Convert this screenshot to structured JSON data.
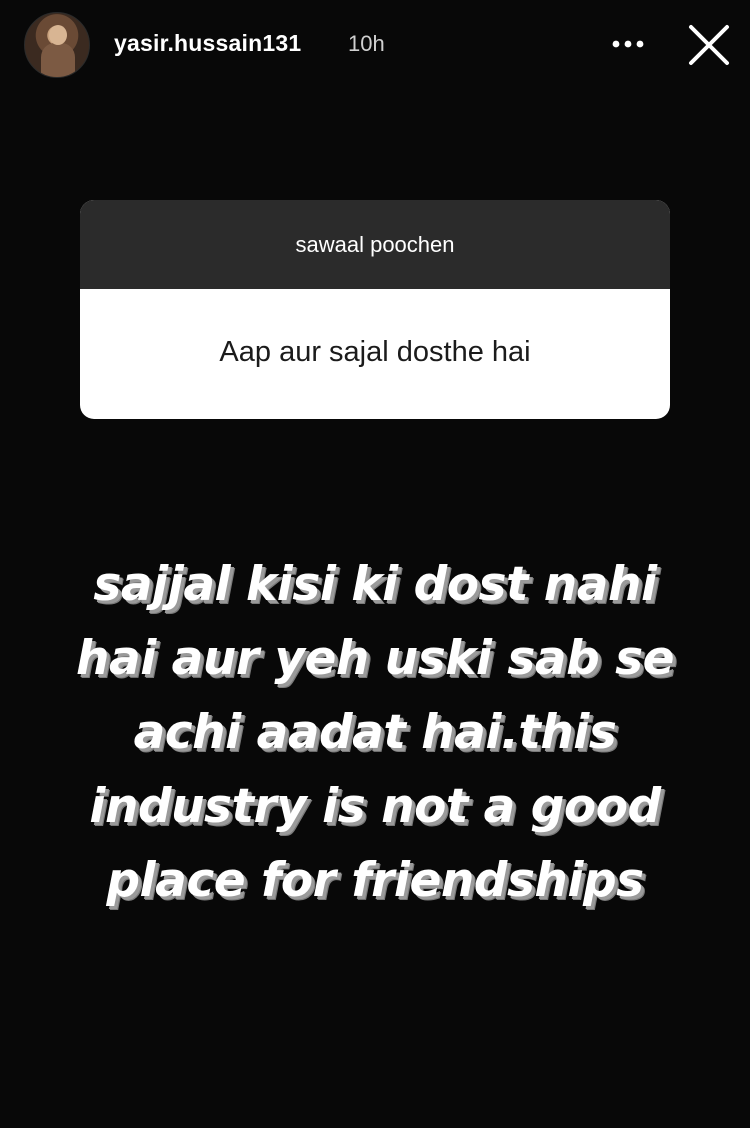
{
  "header": {
    "username": "yasir.hussain131",
    "time": "10h",
    "more_icon": "more-horizontal-icon",
    "close_icon": "close-icon"
  },
  "question_sticker": {
    "prompt": "sawaal poochen",
    "question": "Aap aur sajal dosthe hai"
  },
  "answer": {
    "lines": [
      "sajjal kisi ki dost nahi",
      "hai aur yeh uski sab se",
      "achi aadat hai.this",
      "industry is not a good",
      "place for friendships"
    ]
  },
  "colors": {
    "background": "#080808",
    "card_header": "#2b2b2b",
    "card_body": "#ffffff",
    "text_shadow": "#9a9a9a"
  }
}
